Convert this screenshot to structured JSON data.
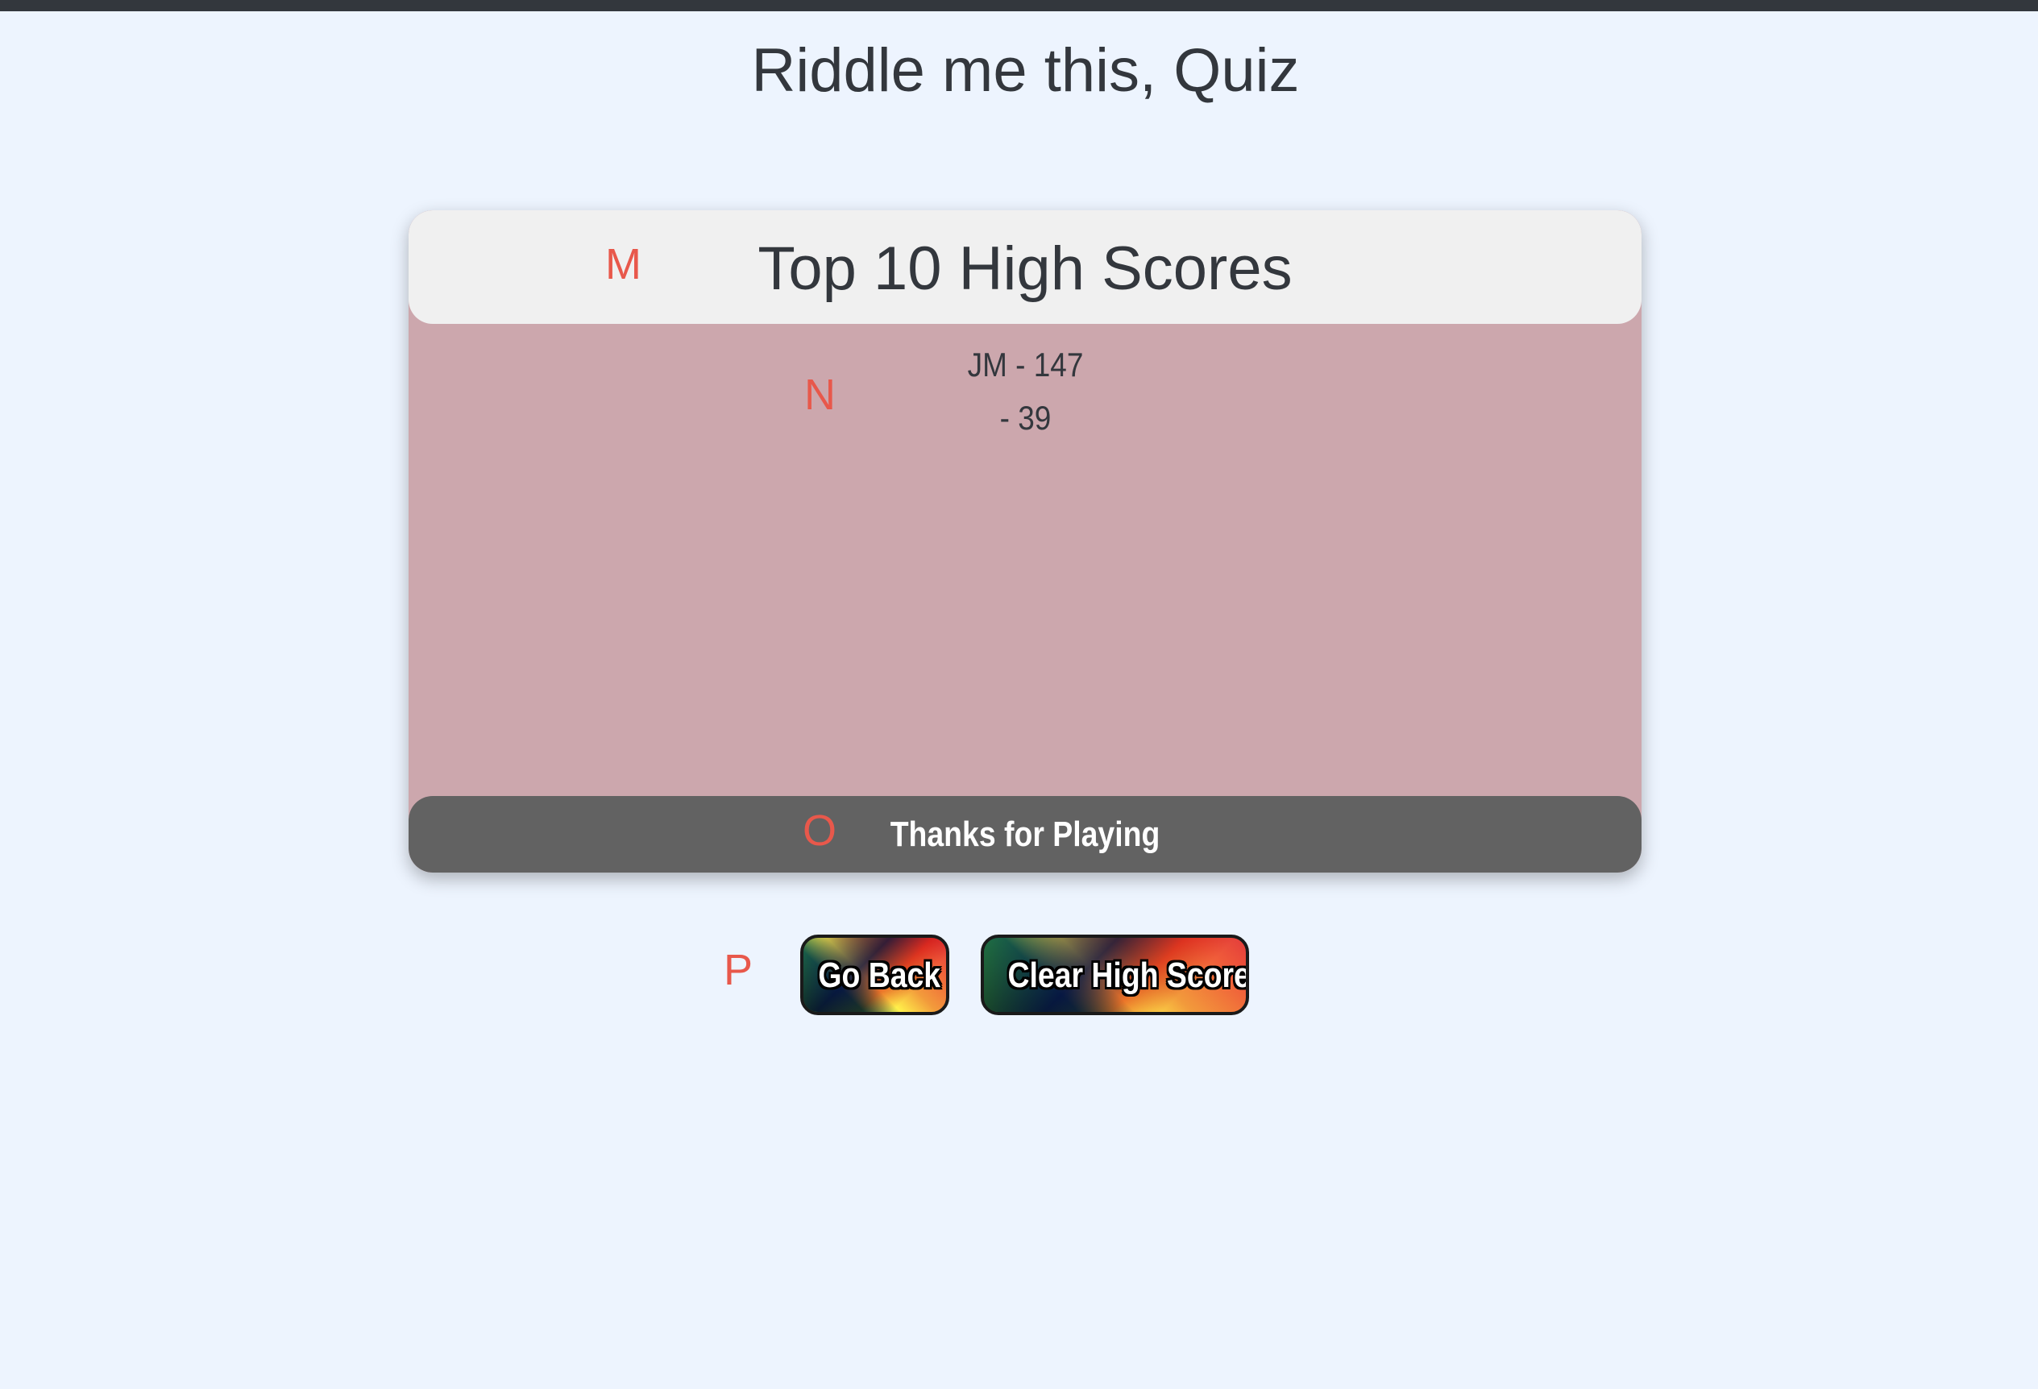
{
  "page": {
    "title": "Riddle me this, Quiz"
  },
  "card": {
    "title": "Top 10 High Scores",
    "scores": [
      {
        "text": "JM - 147"
      },
      {
        "text": "- 39"
      }
    ],
    "footer": "Thanks for Playing"
  },
  "buttons": {
    "go_back": "Go Back",
    "clear": "Clear High Score"
  },
  "markers": {
    "m": "M",
    "n": "N",
    "o": "O",
    "p": "P"
  },
  "colors": {
    "background": "#edf4fe",
    "card_body": "#cca7ad",
    "card_header": "#f0f0f0",
    "card_footer": "#626262",
    "marker": "#e8584b",
    "text": "#33373d"
  }
}
